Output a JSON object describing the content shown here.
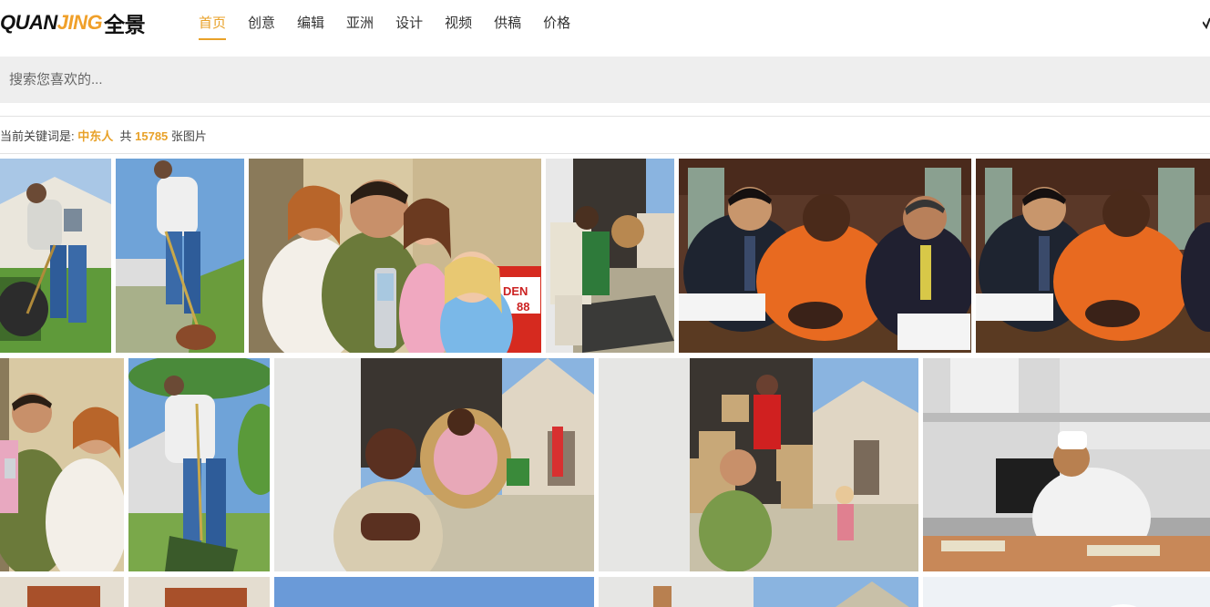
{
  "brand": {
    "logo_quan": "QUAN",
    "logo_jing": "JING",
    "logo_cn": "全景"
  },
  "nav": {
    "items": [
      {
        "label": "首页",
        "active": true
      },
      {
        "label": "创意",
        "active": false
      },
      {
        "label": "编辑",
        "active": false
      },
      {
        "label": "亚洲",
        "active": false
      },
      {
        "label": "设计",
        "active": false
      },
      {
        "label": "视频",
        "active": false
      },
      {
        "label": "供稿",
        "active": false
      },
      {
        "label": "价格",
        "active": false
      }
    ]
  },
  "search": {
    "placeholder": "搜索您喜欢的..."
  },
  "results": {
    "prefix": "当前关键词是:",
    "keyword": "中东人",
    "total_label": "共",
    "count": "15785",
    "suffix": "张图片"
  },
  "photo_sign": {
    "line1": "DEN",
    "line2": "88"
  },
  "colors": {
    "accent": "#e8a128",
    "search_bg": "#eeeeee",
    "divider": "#e2e2e2"
  }
}
